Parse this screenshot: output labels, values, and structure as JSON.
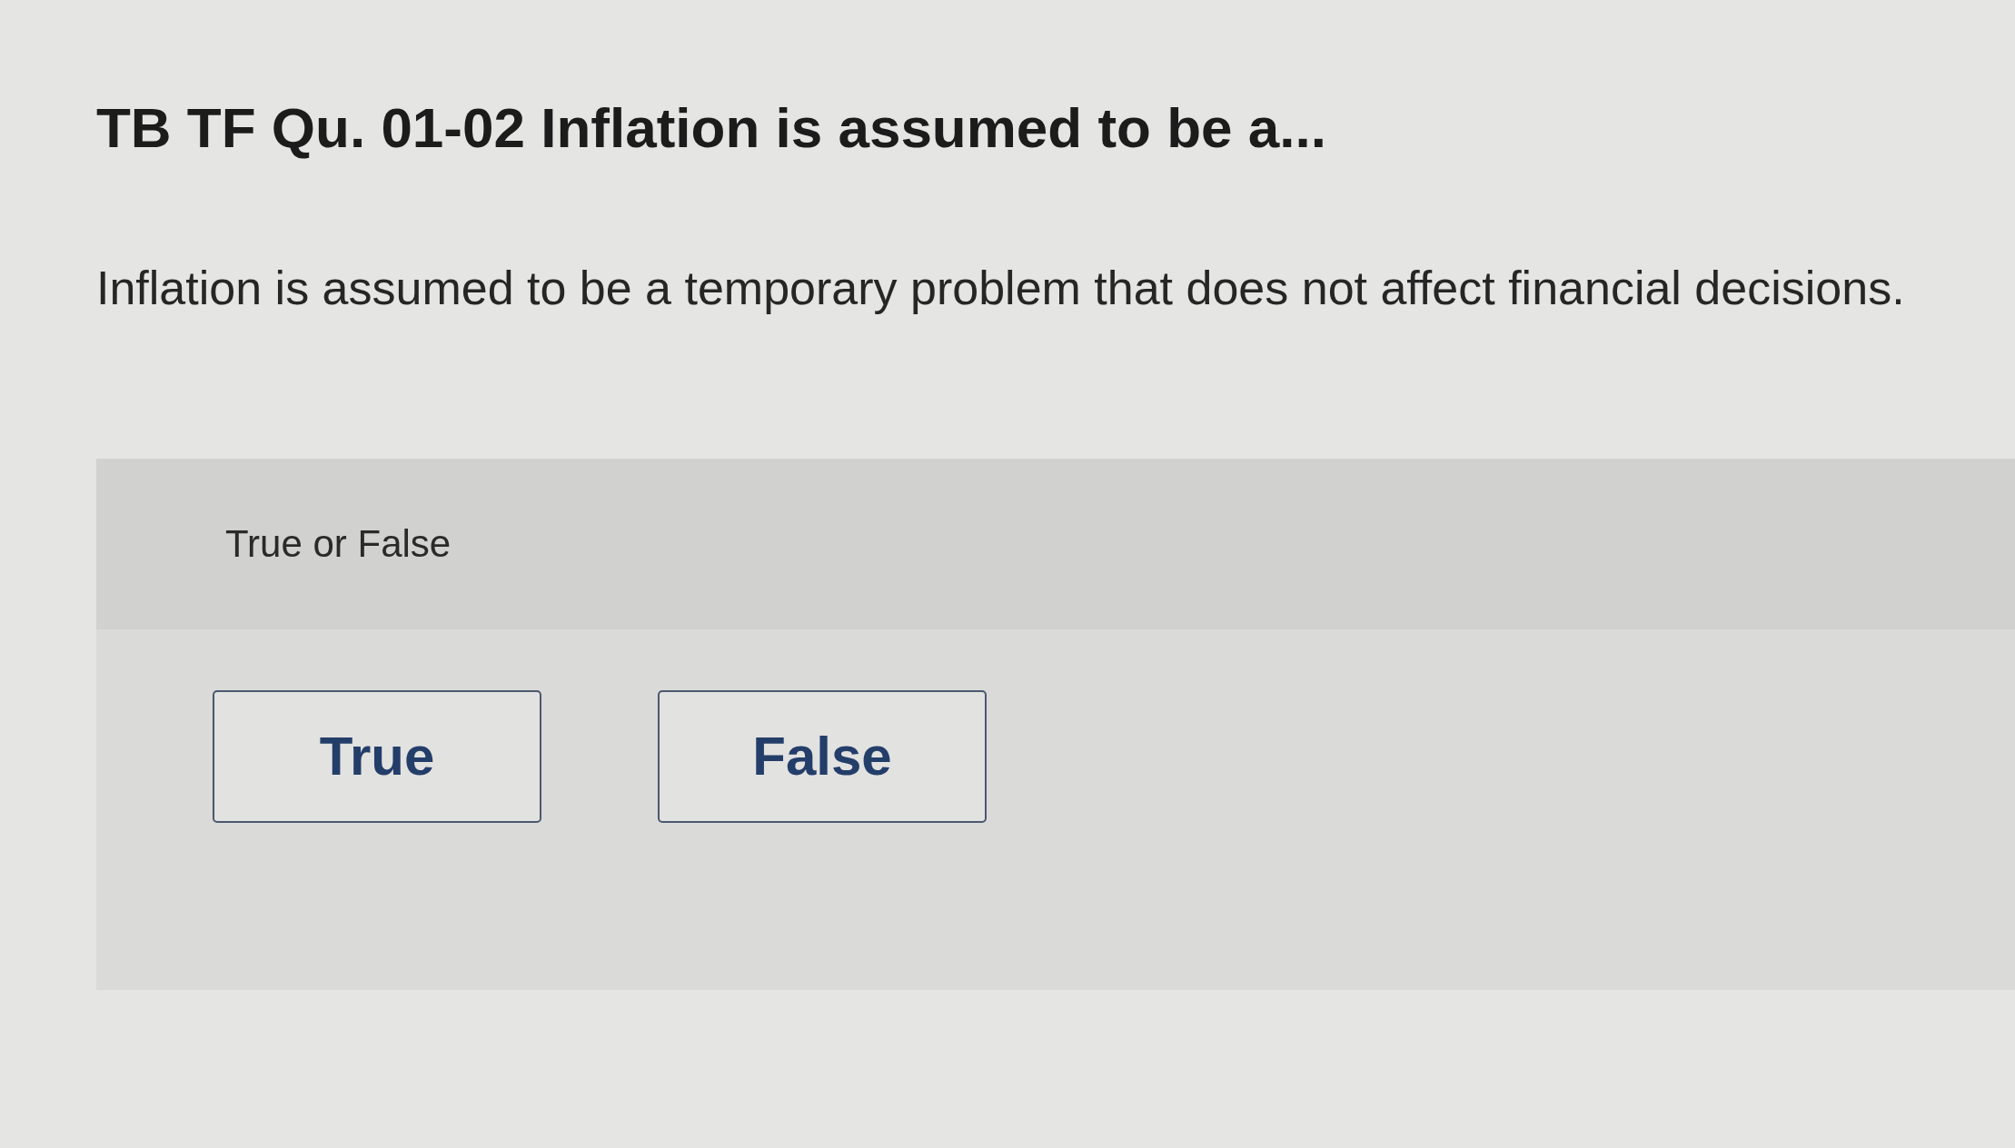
{
  "question": {
    "title": "TB TF Qu. 01-02 Inflation is assumed to be a...",
    "text": "Inflation is assumed to be a temporary problem that does not affect financial decisions."
  },
  "answer_panel": {
    "prompt": "True or False",
    "options": [
      {
        "label": "True",
        "selected": false
      },
      {
        "label": "False",
        "selected": false
      }
    ]
  }
}
